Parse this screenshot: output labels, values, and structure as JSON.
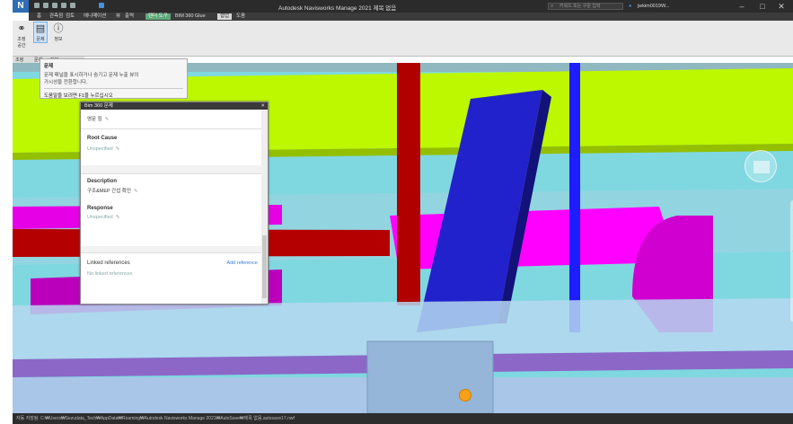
{
  "app": {
    "logo": "N",
    "window_title": "Autodesk Navisworks Manage 2021   제목 없음",
    "search_placeholder": "키워드 또는 구문 입력",
    "user": "jwkim0019W..."
  },
  "menu": {
    "tabs": [
      "홈",
      "관측점",
      "검토",
      "애니메이션",
      "뷰",
      "출력",
      "렌더 도구",
      "BIM 360 Glue",
      "협업",
      "도움"
    ],
    "active_index": 6,
    "selected_index": 8
  },
  "ribbon": {
    "buttons": [
      {
        "label": "조정 공간",
        "icon": "link-icon"
      },
      {
        "label": "문제",
        "icon": "issue-icon"
      },
      {
        "label": "정보",
        "icon": "info-icon"
      }
    ],
    "group_labels": [
      "조정",
      "문제",
      "정보"
    ]
  },
  "tooltip": {
    "title": "문제",
    "description": "문제 패널을 표시하거나 숨기고 문제 누출 뷰의 가시성을 전환합니다.",
    "help": "도움말을 보려면 F1을 누르십시오"
  },
  "panel": {
    "title": "Bim 360 문제",
    "top_value": "영문 킴",
    "root_cause_label": "Root Cause",
    "root_cause_value": "Unspecified",
    "description_label": "Description",
    "description_value": "구조&MEP 간섭 확인",
    "response_label": "Response",
    "response_value": "Unspecified",
    "linked_label": "Linked references",
    "add_reference": "Add reference",
    "no_linked": "No linked references"
  },
  "status": {
    "text": "자동 저장됨: C:₩Users₩Sezudata_Tech₩AppData₩Roaming₩Autodesk Navisworks Manage 2021₩AutoSave₩제목 없음.autosave17.nwf"
  },
  "colors": {
    "floor_green": "#bdf700",
    "pipe_magenta": "#ff00ff",
    "pipe_red": "#c80000",
    "beam_blue": "#2222cc",
    "background_cyan": "#7fd8e0"
  }
}
